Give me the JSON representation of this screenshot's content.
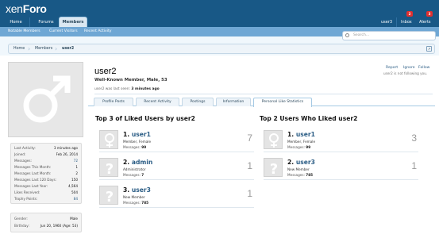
{
  "header": {
    "logo_a": "xen",
    "logo_b": "Foro",
    "tabs": [
      "Home",
      "Forums",
      "Members"
    ],
    "user": "user3",
    "inbox": "Inbox",
    "inbox_count": "2",
    "alerts": "Alerts",
    "alerts_count": "3"
  },
  "subnav": {
    "links": [
      "Notable Members",
      "Current Visitors",
      "Recent Activity"
    ]
  },
  "search": {
    "placeholder": "Search..."
  },
  "breadcrumb": [
    "Home",
    "Members",
    "user2"
  ],
  "sidebar": {
    "stats": [
      {
        "k": "Last Activity:",
        "v": "3 minutes ago"
      },
      {
        "k": "Joined:",
        "v": "Feb 26, 2014"
      },
      {
        "k": "Messages:",
        "v": "72"
      },
      {
        "k": "Messages This Month:",
        "v": "1"
      },
      {
        "k": "Messages Last Month:",
        "v": "2"
      },
      {
        "k": "Messages Last 120 Days:",
        "v": "150"
      },
      {
        "k": "Messages Last Year:",
        "v": "4,564"
      },
      {
        "k": "Likes Received:",
        "v": "504"
      },
      {
        "k": "Trophy Points:",
        "v": "84"
      }
    ],
    "info": [
      {
        "k": "Gender:",
        "v": "Male"
      },
      {
        "k": "Birthday:",
        "v": "Jun 20, 1960 (Age: 53)"
      }
    ]
  },
  "profile": {
    "username": "user2",
    "title": "Well-Known Member, Male, 53",
    "last_seen_label": "user2 was last seen:",
    "last_seen_value": "3 minutes ago",
    "actions": [
      "Report",
      "Ignore",
      "Follow"
    ],
    "follow_note": "user2 is not following you."
  },
  "tabs": [
    "Profile Posts",
    "Recent Activity",
    "Postings",
    "Information",
    "Personal Like Statistics"
  ],
  "liked": {
    "title": "Top 3 of Liked Users by user2",
    "items": [
      {
        "rank": "1.",
        "name": "user1",
        "role": "Member, Female",
        "messages_label": "Messages:",
        "messages": "99",
        "count": "7"
      },
      {
        "rank": "2.",
        "name": "admin",
        "role": "Administrator",
        "messages_label": "Messages:",
        "messages": "7",
        "count": "1"
      },
      {
        "rank": "3.",
        "name": "user3",
        "role": "New Member",
        "messages_label": "Messages:",
        "messages": "785",
        "count": "1"
      }
    ]
  },
  "likers": {
    "title": "Top 2 Users Who Liked user2",
    "items": [
      {
        "rank": "1.",
        "name": "user1",
        "role": "Member, Female",
        "messages_label": "Messages:",
        "messages": "99",
        "count": "3"
      },
      {
        "rank": "2.",
        "name": "user3",
        "role": "New Member",
        "messages_label": "Messages:",
        "messages": "785",
        "count": "1"
      }
    ]
  }
}
